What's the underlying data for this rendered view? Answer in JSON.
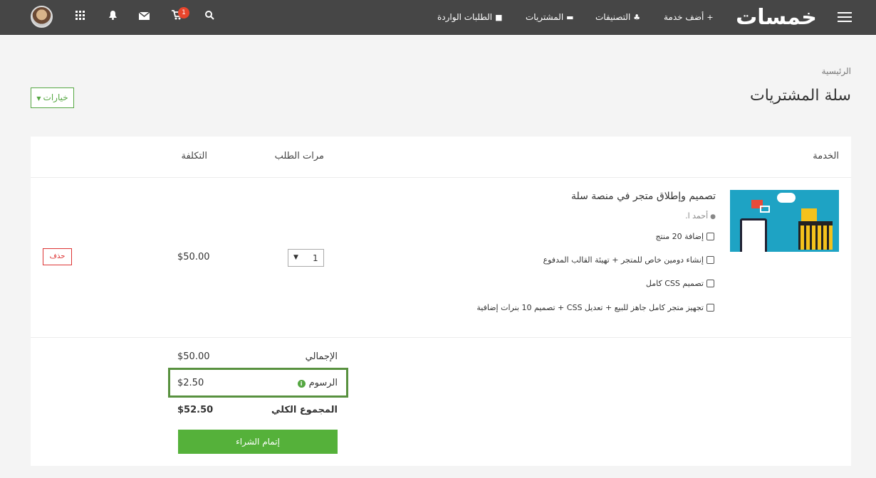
{
  "header": {
    "logo_text": "خمسات",
    "nav": {
      "add_service": "أضف خدمة",
      "categories": "التصنيفات",
      "purchases": "المشتريات",
      "incoming_orders": "الطلبات الواردة"
    },
    "cart_count": "1"
  },
  "breadcrumb": "الرئيسية",
  "page_title": "سلة المشتريات",
  "options_label": "خيارات",
  "table": {
    "headers": {
      "service": "الخدمة",
      "quantity": "مرات الطلب",
      "cost": "التكلفة"
    },
    "item": {
      "title": "تصميم وإطلاق متجر في منصة سلة",
      "seller": "أحمد ا.",
      "addons": [
        "إضافة 20 منتج",
        "إنشاء دومين خاص للمتجر + تهيئة القالب المدفوع",
        "تصميم CSS كامل",
        "تجهيز متجر كامل جاهز للبيع + تعديل CSS + تصميم 10 بنرات إضافية"
      ],
      "quantity": "1",
      "price": "$50.00",
      "delete_label": "حذف"
    }
  },
  "summary": {
    "subtotal_label": "الإجمالي",
    "subtotal_value": "$50.00",
    "fees_label": "الرسوم",
    "fees_value": "$2.50",
    "total_label": "المجموع الكلي",
    "total_value": "$52.50",
    "checkout_label": "إتمام الشراء"
  }
}
